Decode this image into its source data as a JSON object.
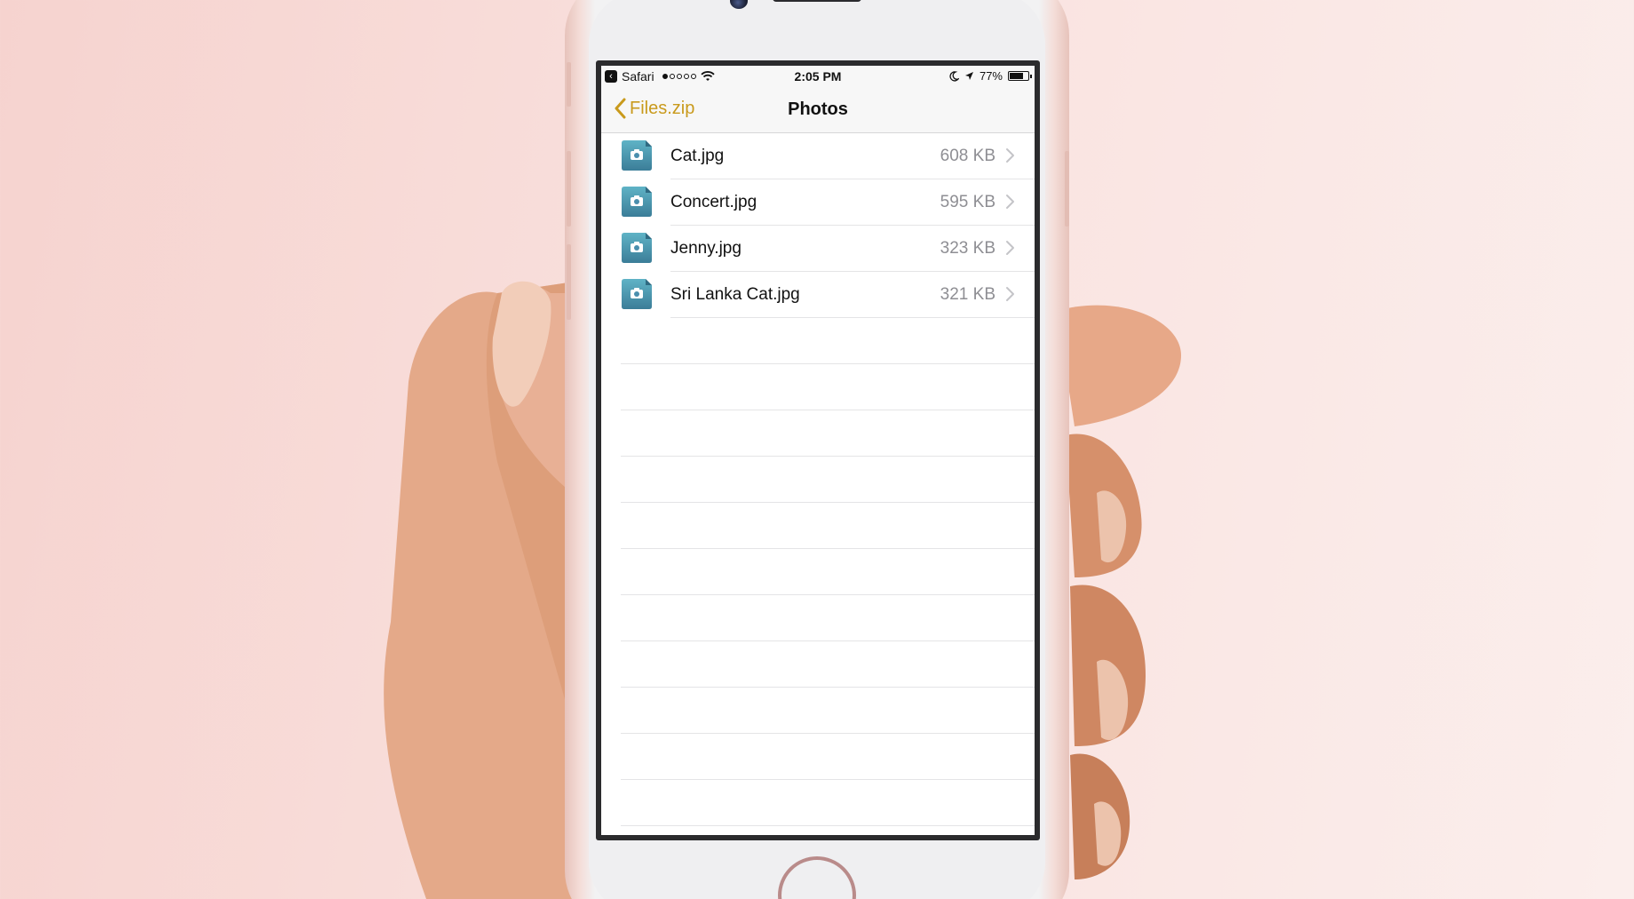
{
  "status_bar": {
    "back_app": "Safari",
    "time": "2:05 PM",
    "battery": "77%",
    "battery_level": 0.77,
    "signal_bars_filled": 1,
    "signal_bars_total": 5
  },
  "nav": {
    "back_label": "Files.zip",
    "title": "Photos"
  },
  "files": [
    {
      "name": "Cat.jpg",
      "size": "608 KB"
    },
    {
      "name": "Concert.jpg",
      "size": "595 KB"
    },
    {
      "name": "Jenny.jpg",
      "size": "323 KB"
    },
    {
      "name": "Sri Lanka Cat.jpg",
      "size": "321 KB"
    }
  ],
  "colors": {
    "accent": "#c99a1c",
    "file_icon": "#4a8fae",
    "secondary_text": "#8e8e93"
  },
  "icons": {
    "file": "photo-file-icon",
    "row_disclosure": "chevron-right-icon",
    "back": "chevron-left-icon"
  }
}
